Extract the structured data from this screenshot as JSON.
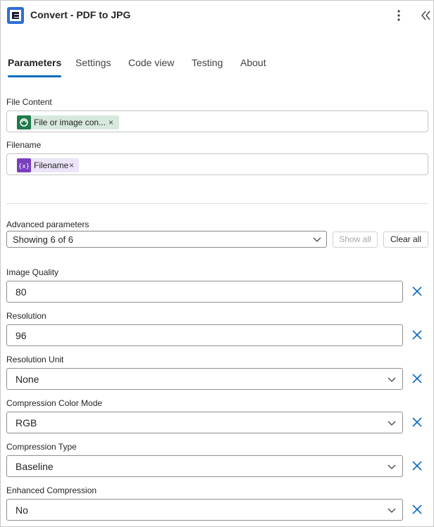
{
  "header": {
    "title": "Convert - PDF to JPG",
    "icons": {
      "logo": "encodian-logo",
      "more": "more-vertical-icon",
      "collapse": "collapse-icon"
    }
  },
  "tabs": [
    {
      "label": "Parameters",
      "active": true
    },
    {
      "label": "Settings",
      "active": false
    },
    {
      "label": "Code view",
      "active": false
    },
    {
      "label": "Testing",
      "active": false
    },
    {
      "label": "About",
      "active": false
    }
  ],
  "file_content": {
    "label": "File Content",
    "token": {
      "text": "File or image con...",
      "icon": "sharepoint-icon",
      "color": "#d7e9dd",
      "icon_color": "#1f7a4c"
    }
  },
  "filename": {
    "label": "Filename",
    "token": {
      "text": "Filename",
      "icon": "variable-icon",
      "color": "#ece4f7",
      "icon_color": "#7a3fbf"
    }
  },
  "advanced": {
    "label": "Advanced parameters",
    "selected": "Showing 6 of 6",
    "show_all": "Show all",
    "clear_all": "Clear all"
  },
  "params": [
    {
      "label": "Image Quality",
      "value": "80",
      "type": "text"
    },
    {
      "label": "Resolution",
      "value": "96",
      "type": "text"
    },
    {
      "label": "Resolution Unit",
      "value": "None",
      "type": "select"
    },
    {
      "label": "Compression Color Mode",
      "value": "RGB",
      "type": "select"
    },
    {
      "label": "Compression Type",
      "value": "Baseline",
      "type": "select"
    },
    {
      "label": "Enhanced Compression",
      "value": "No",
      "type": "select"
    }
  ],
  "colors": {
    "accent": "#0f6cbd",
    "clear_icon": "#0f6cbd"
  }
}
